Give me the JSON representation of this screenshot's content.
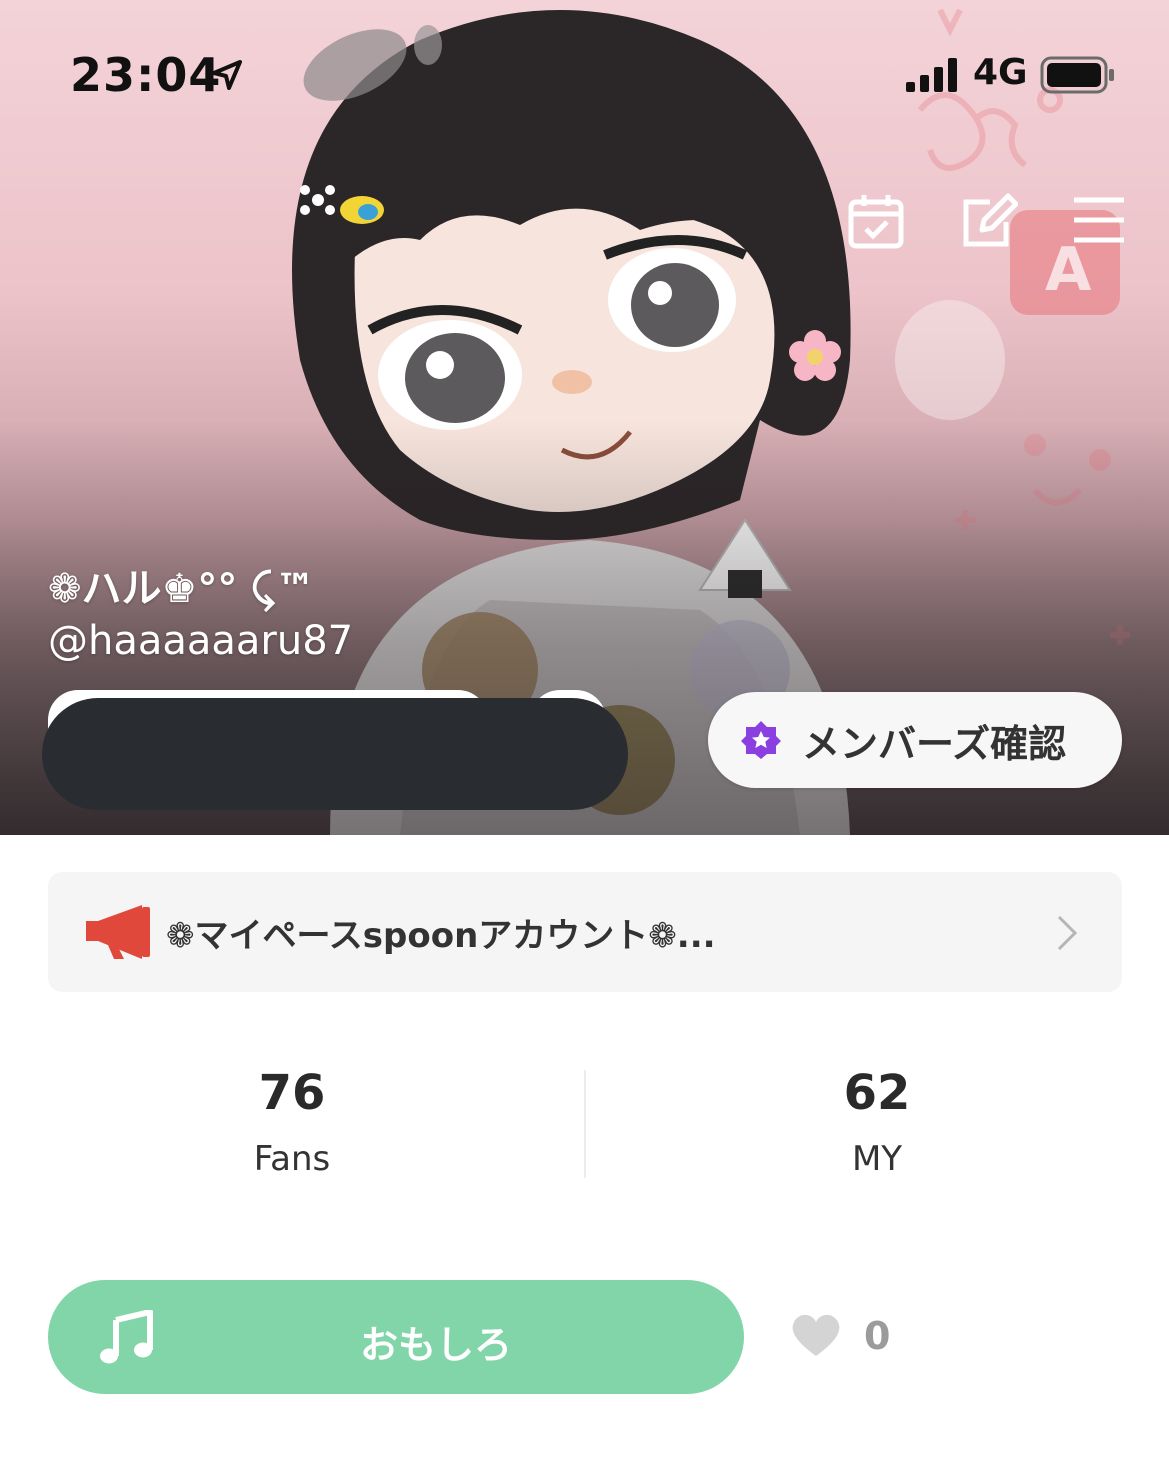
{
  "status_bar": {
    "time": "23:04",
    "network": "4G",
    "icons": [
      "location-arrow-icon",
      "signal-bars-icon",
      "battery-icon"
    ]
  },
  "header_actions": {
    "icons": [
      "calendar-check-icon",
      "edit-icon",
      "menu-icon"
    ]
  },
  "profile": {
    "nickname": "❁ハル♚°° ⤹™",
    "user_id": "@haaaaaaru87",
    "members_button": "メンバーズ確認",
    "members_icon": "flower-badge-icon",
    "accent_color": "#8a3fe0"
  },
  "notice": {
    "icon": "megaphone-icon",
    "text": "❁マイペースspoonアカウント❁...",
    "icon_color": "#e0483b"
  },
  "stats": [
    {
      "value": "76",
      "label": "Fans"
    },
    {
      "value": "62",
      "label": "MY"
    }
  ],
  "play": {
    "label": "おもしろ",
    "icon": "music-note-icon",
    "color": "#82d5a8"
  },
  "likes": {
    "icon": "heart-icon",
    "count": "0"
  }
}
